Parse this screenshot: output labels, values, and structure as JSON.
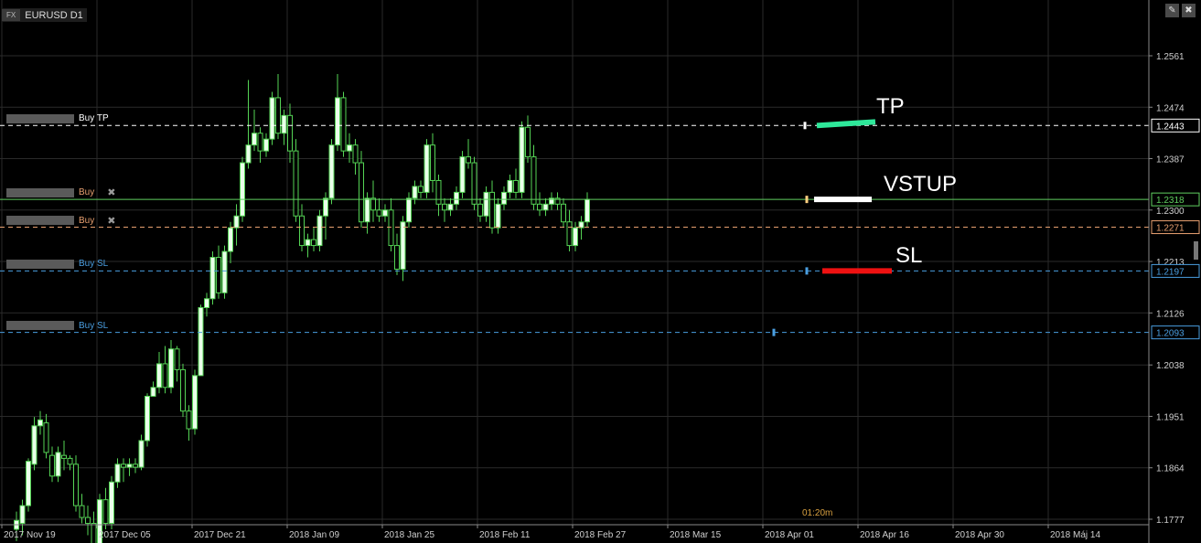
{
  "window": {
    "badge": "FX",
    "symbol": "EURUSD D1",
    "buttons": [
      {
        "name": "edit-button",
        "icon": "pencil-icon",
        "glyph": "✎"
      },
      {
        "name": "close-button",
        "icon": "close-icon",
        "glyph": "✖"
      }
    ]
  },
  "colors": {
    "background": "#000000",
    "grid": "#2a2a2a",
    "candle_up": "#eaffea",
    "candle_down": "#000000",
    "candle_border": "#55d455",
    "current_price": "#5fcf5f",
    "tp": "#ffffff",
    "entry": "#e8a070",
    "sl": "#4a9ee0"
  },
  "price_axis": {
    "ticks": [
      "1.2561",
      "1.2474",
      "1.2387",
      "1.2300",
      "1.2213",
      "1.2126",
      "1.2038",
      "1.1951",
      "1.1864",
      "1.1777"
    ],
    "tick_values": [
      1.2561,
      1.2474,
      1.2387,
      1.23,
      1.2213,
      1.2126,
      1.2038,
      1.1951,
      1.1864,
      1.1777
    ],
    "badges": [
      {
        "label": "1.2443",
        "value": 1.2443,
        "type": "tp"
      },
      {
        "label": "1.2318",
        "value": 1.2318,
        "type": "current"
      },
      {
        "label": "1.2271",
        "value": 1.2271,
        "type": "entry"
      },
      {
        "label": "1.2197",
        "value": 1.2197,
        "type": "sl"
      },
      {
        "label": "1.2093",
        "value": 1.2093,
        "type": "sl"
      }
    ]
  },
  "time_axis": {
    "labels": [
      "2017 Nov 19",
      "2017 Dec 05",
      "2017 Dec 21",
      "2018 Jan 09",
      "2018 Jan 25",
      "2018 Feb 11",
      "2018 Feb 27",
      "2018 Mar 15",
      "2018 Apr 01",
      "2018 Apr 16",
      "2018 Apr 30",
      "2018 Máj 14"
    ]
  },
  "orders": [
    {
      "name": "order-buy-tp",
      "text": "Buy  TP",
      "price": 1.2443,
      "color": "#ffffff",
      "closable": false
    },
    {
      "name": "order-buy-1",
      "text": "Buy",
      "price": 1.2318,
      "color": "#e8a070",
      "closable": true
    },
    {
      "name": "order-buy-2",
      "text": "Buy",
      "price": 1.2271,
      "color": "#e8a070",
      "closable": true
    },
    {
      "name": "order-buy-sl-1",
      "text": "Buy  SL",
      "price": 1.2197,
      "color": "#4a9ee0",
      "closable": false
    },
    {
      "name": "order-buy-sl-2",
      "text": "Buy  SL",
      "price": 1.2093,
      "color": "#4a9ee0",
      "closable": false
    }
  ],
  "annotations": [
    {
      "name": "annotation-tp",
      "text": "TP",
      "color": "#2ee89a",
      "price": 1.2443
    },
    {
      "name": "annotation-vstup",
      "text": "VSTUP",
      "color": "#ffffff",
      "price": 1.2318
    },
    {
      "name": "annotation-sl",
      "text": "SL",
      "color": "#ee1111",
      "price": 1.2197
    }
  ],
  "timer": "01:20m",
  "chart_data": {
    "type": "candlestick",
    "current_price": 1.2318,
    "candles": [
      [
        1.176,
        1.179,
        1.174,
        1.1775
      ],
      [
        1.177,
        1.181,
        1.175,
        1.18
      ],
      [
        1.18,
        1.188,
        1.179,
        1.1875
      ],
      [
        1.187,
        1.195,
        1.186,
        1.1935
      ],
      [
        1.1935,
        1.196,
        1.192,
        1.1945
      ],
      [
        1.194,
        1.1955,
        1.188,
        1.189
      ],
      [
        1.1885,
        1.19,
        1.184,
        1.185
      ],
      [
        1.185,
        1.19,
        1.184,
        1.189
      ],
      [
        1.1885,
        1.191,
        1.186,
        1.188
      ],
      [
        1.188,
        1.1885,
        1.186,
        1.187
      ],
      [
        1.187,
        1.1885,
        1.179,
        1.18
      ],
      [
        1.18,
        1.182,
        1.177,
        1.178
      ],
      [
        1.178,
        1.18,
        1.175,
        1.177
      ],
      [
        1.177,
        1.179,
        1.17,
        1.172
      ],
      [
        1.172,
        1.182,
        1.171,
        1.181
      ],
      [
        1.181,
        1.183,
        1.176,
        1.177
      ],
      [
        1.177,
        1.185,
        1.176,
        1.184
      ],
      [
        1.184,
        1.188,
        1.183,
        1.187
      ],
      [
        1.187,
        1.188,
        1.184,
        1.1865
      ],
      [
        1.1865,
        1.188,
        1.185,
        1.187
      ],
      [
        1.187,
        1.188,
        1.1855,
        1.1865
      ],
      [
        1.1865,
        1.192,
        1.186,
        1.191
      ],
      [
        1.191,
        1.199,
        1.19,
        1.1985
      ],
      [
        1.1985,
        1.201,
        1.199,
        1.2
      ],
      [
        1.2,
        1.206,
        1.199,
        1.204
      ],
      [
        1.204,
        1.207,
        1.199,
        1.2
      ],
      [
        1.2,
        1.208,
        1.199,
        1.2065
      ],
      [
        1.2065,
        1.207,
        1.201,
        1.203
      ],
      [
        1.203,
        1.204,
        1.195,
        1.196
      ],
      [
        1.196,
        1.197,
        1.191,
        1.193
      ],
      [
        1.193,
        1.203,
        1.192,
        1.202
      ],
      [
        1.202,
        1.214,
        1.202,
        1.2135
      ],
      [
        1.2135,
        1.216,
        1.212,
        1.215
      ],
      [
        1.215,
        1.223,
        1.214,
        1.222
      ],
      [
        1.222,
        1.224,
        1.215,
        1.216
      ],
      [
        1.216,
        1.224,
        1.215,
        1.223
      ],
      [
        1.223,
        1.228,
        1.221,
        1.227
      ],
      [
        1.227,
        1.231,
        1.224,
        1.229
      ],
      [
        1.229,
        1.239,
        1.228,
        1.238
      ],
      [
        1.238,
        1.252,
        1.237,
        1.241
      ],
      [
        1.241,
        1.247,
        1.24,
        1.243
      ],
      [
        1.243,
        1.244,
        1.238,
        1.24
      ],
      [
        1.24,
        1.243,
        1.239,
        1.242
      ],
      [
        1.242,
        1.25,
        1.241,
        1.249
      ],
      [
        1.249,
        1.253,
        1.242,
        1.243
      ],
      [
        1.243,
        1.247,
        1.241,
        1.246
      ],
      [
        1.246,
        1.248,
        1.238,
        1.24
      ],
      [
        1.24,
        1.242,
        1.228,
        1.229
      ],
      [
        1.229,
        1.231,
        1.223,
        1.224
      ],
      [
        1.224,
        1.226,
        1.222,
        1.225
      ],
      [
        1.225,
        1.227,
        1.223,
        1.224
      ],
      [
        1.224,
        1.23,
        1.223,
        1.229
      ],
      [
        1.229,
        1.233,
        1.225,
        1.232
      ],
      [
        1.232,
        1.242,
        1.231,
        1.241
      ],
      [
        1.241,
        1.253,
        1.24,
        1.249
      ],
      [
        1.249,
        1.25,
        1.239,
        1.24
      ],
      [
        1.24,
        1.243,
        1.238,
        1.241
      ],
      [
        1.241,
        1.242,
        1.236,
        1.238
      ],
      [
        1.238,
        1.24,
        1.227,
        1.228
      ],
      [
        1.228,
        1.233,
        1.226,
        1.232
      ],
      [
        1.232,
        1.235,
        1.228,
        1.23
      ],
      [
        1.23,
        1.232,
        1.228,
        1.229
      ],
      [
        1.229,
        1.231,
        1.228,
        1.23
      ],
      [
        1.23,
        1.232,
        1.223,
        1.224
      ],
      [
        1.224,
        1.226,
        1.219,
        1.22
      ],
      [
        1.22,
        1.229,
        1.218,
        1.228
      ],
      [
        1.228,
        1.233,
        1.227,
        1.232
      ],
      [
        1.232,
        1.235,
        1.231,
        1.234
      ],
      [
        1.234,
        1.235,
        1.232,
        1.233
      ],
      [
        1.233,
        1.242,
        1.232,
        1.241
      ],
      [
        1.241,
        1.243,
        1.233,
        1.235
      ],
      [
        1.235,
        1.236,
        1.229,
        1.231
      ],
      [
        1.231,
        1.232,
        1.228,
        1.23
      ],
      [
        1.23,
        1.232,
        1.229,
        1.231
      ],
      [
        1.231,
        1.234,
        1.23,
        1.233
      ],
      [
        1.233,
        1.24,
        1.232,
        1.239
      ],
      [
        1.239,
        1.242,
        1.237,
        1.238
      ],
      [
        1.238,
        1.239,
        1.23,
        1.231
      ],
      [
        1.231,
        1.232,
        1.228,
        1.229
      ],
      [
        1.229,
        1.234,
        1.228,
        1.233
      ],
      [
        1.233,
        1.235,
        1.226,
        1.227
      ],
      [
        1.227,
        1.232,
        1.226,
        1.231
      ],
      [
        1.231,
        1.234,
        1.23,
        1.233
      ],
      [
        1.233,
        1.236,
        1.232,
        1.235
      ],
      [
        1.235,
        1.237,
        1.232,
        1.233
      ],
      [
        1.233,
        1.245,
        1.232,
        1.244
      ],
      [
        1.244,
        1.246,
        1.238,
        1.239
      ],
      [
        1.239,
        1.241,
        1.23,
        1.231
      ],
      [
        1.231,
        1.233,
        1.229,
        1.23
      ],
      [
        1.23,
        1.232,
        1.229,
        1.231
      ],
      [
        1.231,
        1.233,
        1.23,
        1.232
      ],
      [
        1.232,
        1.233,
        1.23,
        1.231
      ],
      [
        1.231,
        1.232,
        1.227,
        1.228
      ],
      [
        1.228,
        1.23,
        1.223,
        1.224
      ],
      [
        1.224,
        1.228,
        1.223,
        1.227
      ],
      [
        1.227,
        1.229,
        1.225,
        1.228
      ],
      [
        1.228,
        1.233,
        1.227,
        1.2318
      ]
    ]
  }
}
